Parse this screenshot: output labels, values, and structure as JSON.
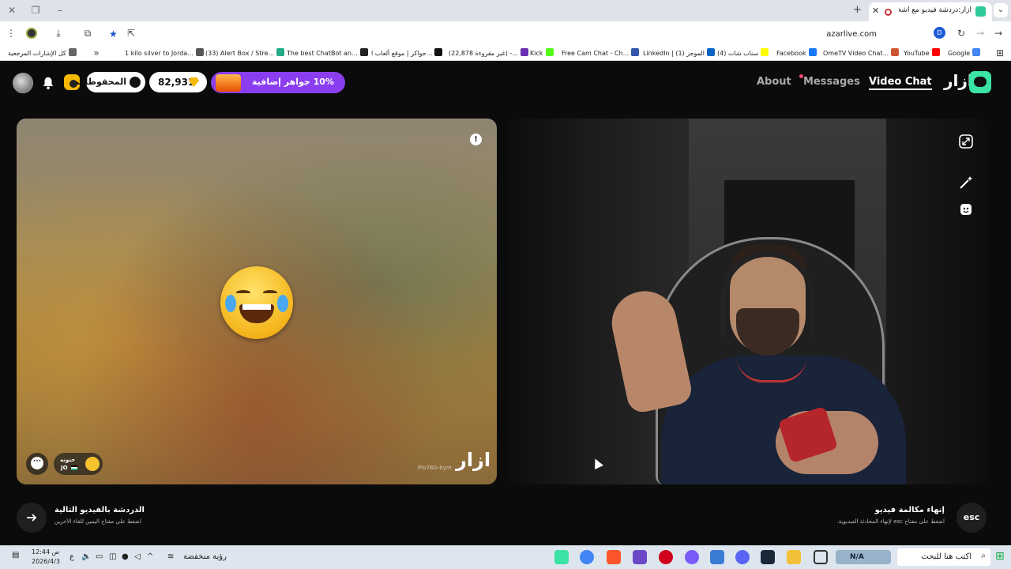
{
  "browser": {
    "tab_title": "أزار:دردشة فيديو مع أشخاص",
    "url": "azarlive.com",
    "bookmarks": [
      {
        "label": "كل الإشارات المرجعية",
        "color": "#666666"
      },
      {
        "label": "1 kilo silver to Jorda...",
        "color": "#555555"
      },
      {
        "label": "(33) Alert Box / Stre...",
        "color": "#22aa88"
      },
      {
        "label": "The best ChatBot an...",
        "color": "#222222"
      },
      {
        "label": "جواكر | موقع ألعاب ا...",
        "color": "#111111"
      },
      {
        "label": "(22,878 غير مقروءة) -...",
        "color": "#6b2fb3"
      },
      {
        "label": "Kick",
        "color": "#53fc18"
      },
      {
        "label": "Free Cam Chat - Ch...",
        "color": "#3355aa"
      },
      {
        "label": "LinkedIn | الموجز (1)",
        "color": "#0a66c2"
      },
      {
        "label": "(4) سناب شات",
        "color": "#fffc00"
      },
      {
        "label": "Facebook",
        "color": "#1877f2"
      },
      {
        "label": "OmeTV Video Chat...",
        "color": "#cc5533"
      },
      {
        "label": "YouTube",
        "color": "#ff0000"
      },
      {
        "label": "Google",
        "color": "#4285f4"
      }
    ]
  },
  "header": {
    "saved_label": "المحفوظات",
    "gems_value": "82,931",
    "promo_label": "10% جواهر إضافية",
    "nav": {
      "about": "About",
      "messages": "Messages",
      "video_chat": "Video Chat"
    },
    "brand": "ازار"
  },
  "left_panel": {
    "user_name": "حنونه",
    "country": "JO",
    "user_id": "Plo78G-bym",
    "watermark": "ازار"
  },
  "bottom": {
    "next_title": "الدردشة بالفيديو التالية",
    "next_sub": "اضغط على مفتاح اليمين للقاء الآخرين",
    "end_title": "إنهاء مكالمة فيديو",
    "end_sub": "اضغط على مفتاح esc لإنهاء المحادثة الفيديوية.",
    "esc_label": "esc"
  },
  "taskbar": {
    "search_placeholder": "اكتب هنا للبحث",
    "weather": "رؤية منخفضة",
    "time": "12:44 ص",
    "date": "2026/4/3",
    "lang": "ع",
    "na_label": "N/A"
  },
  "colors": {
    "accent": "#3be3a5",
    "promo": "#8b3ef0",
    "gem": "#f5b800"
  }
}
